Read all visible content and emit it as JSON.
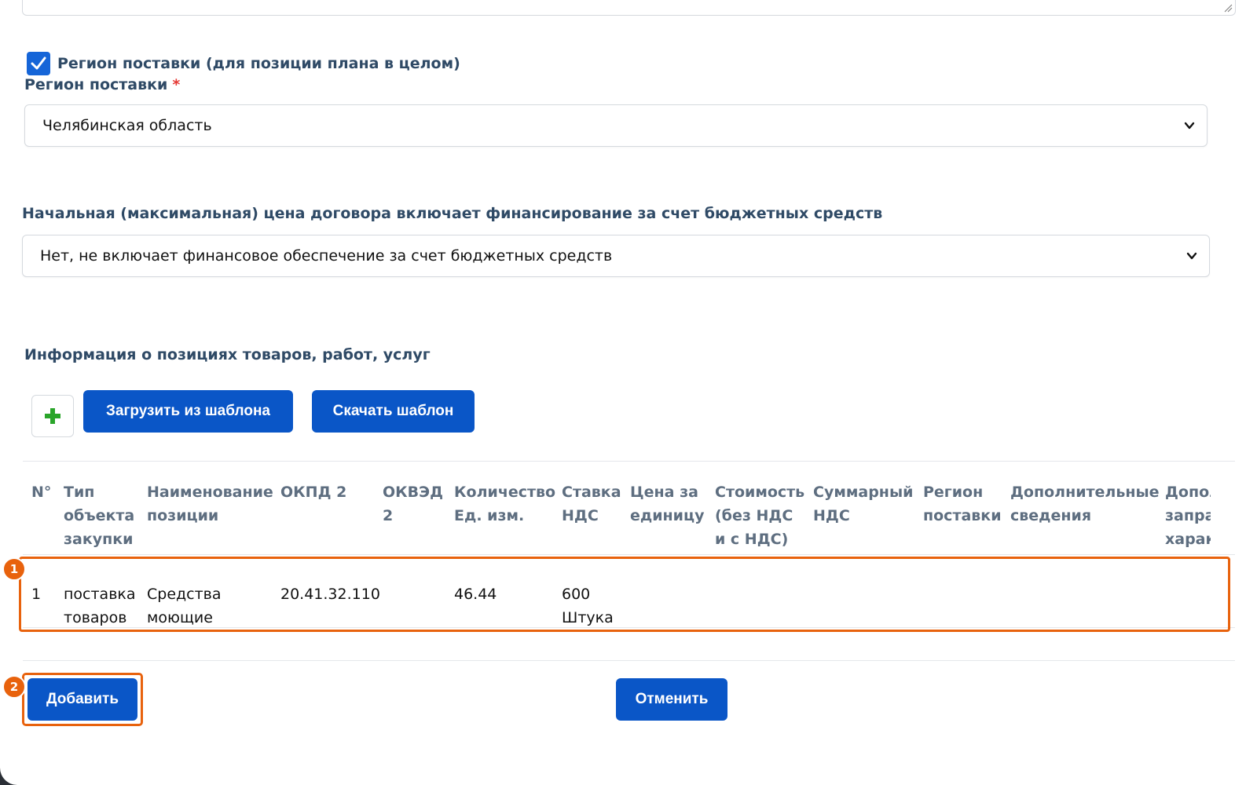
{
  "delivery_region_checkbox": {
    "label": "Регион поставки (для позиции плана в целом)",
    "checked": true
  },
  "delivery_region": {
    "label": "Регион поставки",
    "required_mark": "*",
    "selected": "Челябинская область"
  },
  "budget_funding": {
    "label": "Начальная (максимальная) цена договора включает финансирование за счет бюджетных средств",
    "selected": "Нет, не включает финансовое обеспечение за счет бюджетных средств"
  },
  "positions": {
    "title": "Информация о позициях товаров, работ, услуг",
    "load_template_label": "Загрузить из шаблона",
    "download_template_label": "Скачать шаблон",
    "columns": [
      [
        "N°"
      ],
      [
        "Тип",
        "объекта",
        "закупки"
      ],
      [
        "Наименование",
        "позиции"
      ],
      [
        "ОКПД 2"
      ],
      [
        "ОКВЭД",
        "2"
      ],
      [
        "Количество",
        "Ед. изм."
      ],
      [
        "Ставка",
        "НДС"
      ],
      [
        "Цена за",
        "единицу"
      ],
      [
        "Стоимость",
        "(без НДС",
        "и с НДС)"
      ],
      [
        "Суммарный",
        "НДС"
      ],
      [
        "Регион",
        "поставки"
      ],
      [
        "Дополнительные",
        "сведения"
      ],
      [
        "Допол",
        "запра",
        "харак"
      ]
    ],
    "rows": [
      {
        "num": "1",
        "type": [
          "поставка",
          "товаров"
        ],
        "name": [
          "Средства",
          "моющие"
        ],
        "okpd2": "20.41.32.110",
        "okved2": "",
        "quantity": "46.44",
        "vat_rate": [
          "600",
          "Штука"
        ]
      }
    ]
  },
  "actions": {
    "add_label": "Добавить",
    "cancel_label": "Отменить"
  },
  "annotations": [
    "1",
    "2"
  ],
  "colors": {
    "primary": "#0a56c7",
    "highlight": "#e8620d",
    "checkbox": "#1565d8",
    "plus": "#2aa52a",
    "required": "#e53935"
  }
}
